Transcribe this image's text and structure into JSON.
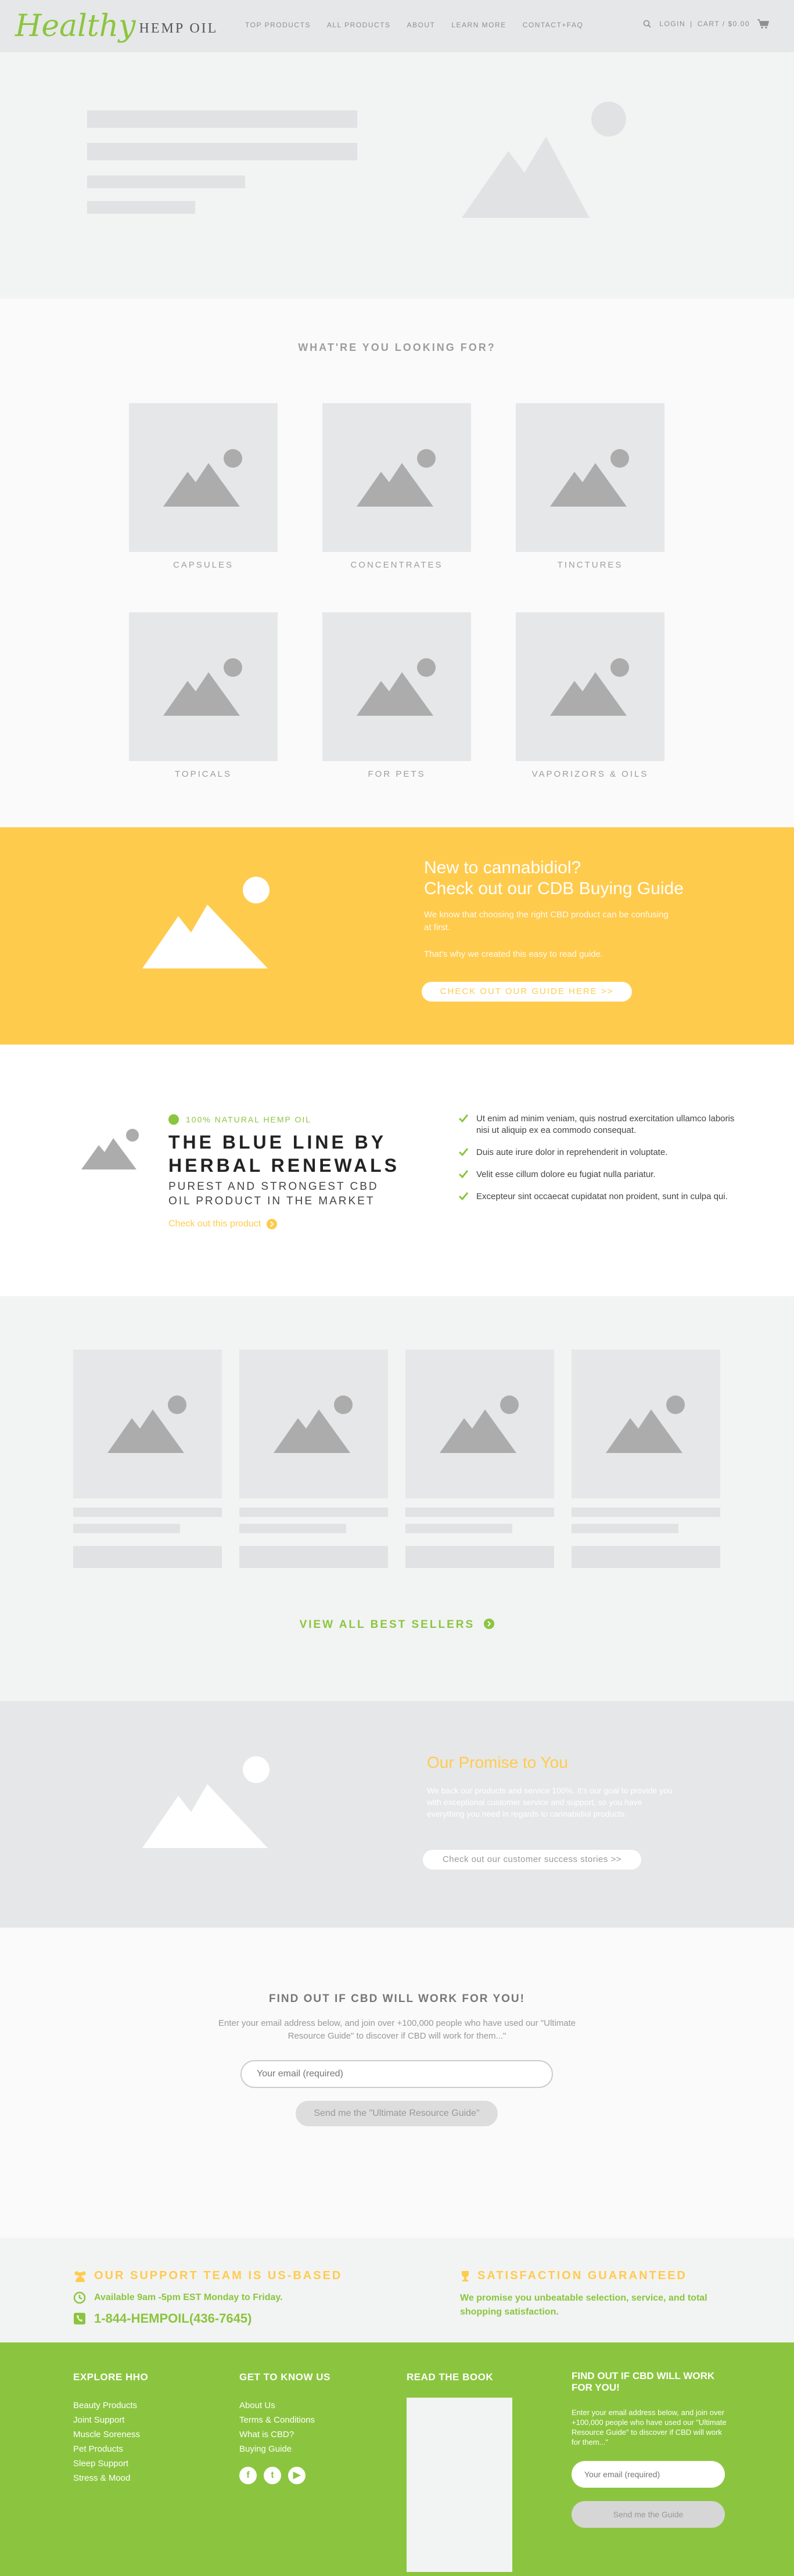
{
  "header": {
    "logo_script": "Healthy",
    "logo_text": "HEMP OIL",
    "nav": [
      "TOP PRODUCTS",
      "ALL PRODUCTS",
      "ABOUT",
      "LEARN MORE",
      "CONTACT+FAQ"
    ],
    "login": "LOGIN",
    "cart": "CART / $0.00"
  },
  "categories": {
    "title": "WHAT'RE YOU LOOKING FOR?",
    "items": [
      "CAPSULES",
      "CONCENTRATES",
      "TINCTURES",
      "TOPICALS",
      "FOR PETS",
      "VAPORIZORS & OILS"
    ]
  },
  "promo": {
    "title_line1": "New to cannabidiol?",
    "title_line2": "Check out our CDB Buying Guide",
    "p1": "We know that choosing the right CBD product can be confusing at first.",
    "p2": "That's why we created this easy to read guide.",
    "button": "CHECK OUT OUR GUIDE HERE >>"
  },
  "feature": {
    "eyebrow": "100% NATURAL HEMP OIL",
    "title_line1": "THE BLUE LINE BY",
    "title_line2": "HERBAL RENEWALS",
    "sub_line1": "PUREST AND STRONGEST CBD",
    "sub_line2": "OIL PRODUCT IN THE MARKET",
    "link": "Check out this product",
    "checks": [
      "Ut enim ad minim veniam, quis nostrud exercitation ullamco laboris nisi ut aliquip ex ea commodo consequat.",
      "Duis aute irure dolor in reprehenderit in voluptate.",
      "Velit esse cillum dolore eu fugiat nulla pariatur.",
      "Excepteur sint occaecat cupidatat non proident, sunt in culpa qui."
    ]
  },
  "sellers": {
    "view_all": "VIEW ALL BEST SELLERS"
  },
  "promise": {
    "title": "Our Promise to You",
    "text": "We back our products and service 100%. It's our goal to provide you with exceptional customer service and support, so you have everything you need in regards to cannabidiol products.",
    "button": "Check out our customer success stories >>"
  },
  "newsletter": {
    "title": "FIND OUT IF CBD WILL WORK FOR YOU!",
    "text": "Enter your email address below, and join over +100,000 people who have used our \"Ultimate Resource Guide\" to discover if CBD will work for them...\"",
    "placeholder": "Your email (required)",
    "button": "Send me the \"Ultimate Resource Guide\""
  },
  "support": {
    "left_title": "OUR SUPPORT TEAM IS US-BASED",
    "hours": "Available 9am -5pm EST Monday to Friday.",
    "phone": "1-844-HEMPOIL(436-7645)",
    "right_title": "SATISFACTION GUARANTEED",
    "right_text_line1": "We promise you unbeatable selection, service, and total",
    "right_text_line2": "shopping satisfaction."
  },
  "footer": {
    "col1_title": "EXPLORE HHO",
    "col1_links": [
      "Beauty Products",
      "Joint Support",
      "Muscle Soreness",
      "Pet Products",
      "Sleep Support",
      "Stress & Mood"
    ],
    "col2_title": "GET TO KNOW US",
    "col2_links": [
      "About Us",
      "Terms & Conditions",
      "What is CBD?",
      "Buying Guide"
    ],
    "col3_title": "READ THE BOOK",
    "nl_title": "FIND OUT IF CBD WILL WORK FOR YOU!",
    "nl_text": "Enter your email address below, and join over +100,000 people who have used our \"Ultimate Resource Guide\" to discover if CBD will work for them...\"",
    "placeholder": "Your email (required)",
    "button": "Send me the Guide"
  },
  "colors": {
    "green": "#8bc53f",
    "yellow": "#ffcb4d",
    "placeholder": "#e6e7e8"
  }
}
